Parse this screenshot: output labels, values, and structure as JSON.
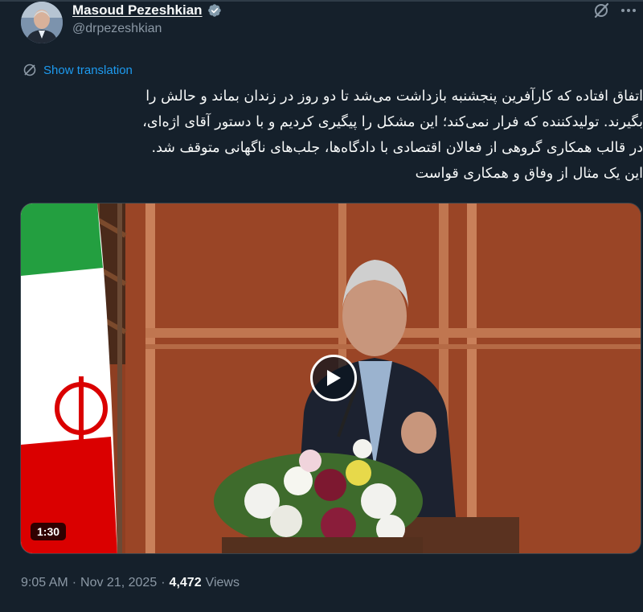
{
  "author": {
    "name": "Masoud Pezeshkian",
    "handle": "@drpezeshkian",
    "verified_color": "#829aab"
  },
  "actions": {
    "grok_icon": "grok-icon",
    "more_icon": "more-icon"
  },
  "translate": {
    "label": "Show translation",
    "icon": "globe-icon"
  },
  "tweet": {
    "lines": [
      "اتفاق افتاده که کارآفرین پنجشنبه بازداشت می‌شد تا دو روز در زندان بماند و حالش را",
      "بگیرند. تولیدکننده که فرار نمی‌کند؛ این مشکل را پیگیری کردیم و با دستور آقای اژه‌ای،",
      "در قالب همکاری گروهی از فعالان اقتصادی با دادگاه‌ها، جلب‌های ناگهانی متوقف شد.",
      "این یک مثال از وفاق و همکاری قواست"
    ]
  },
  "media": {
    "duration": "1:30",
    "play_icon": "play-icon"
  },
  "meta": {
    "time": "9:05 AM",
    "separator": "·",
    "date": "Nov 21, 2025",
    "views_count": "4,472",
    "views_label": "Views"
  },
  "colors": {
    "background": "#15202b",
    "text": "#f7f9f9",
    "muted": "#8b98a5",
    "link": "#1d9bf0"
  }
}
